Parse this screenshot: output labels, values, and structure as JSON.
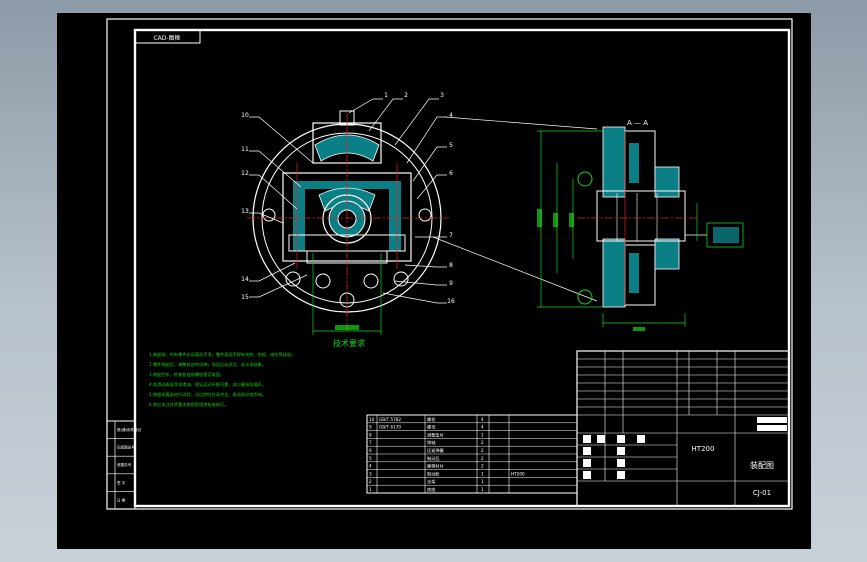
{
  "drawing": {
    "corner_label": "CAD-图框",
    "section_label": "A — A",
    "title_heading": "技术要求",
    "notes": [
      "1.装配前，所有零件必须清洗干净，零件表面不得有毛刺、划痕、碰伤等缺陷。",
      "2.零件装配后，调整各部件间隙，保证运动灵活、无卡滞现象。",
      "3.装配完毕，检查各连接螺栓是否紧固。",
      "4.各滑动表面涂润滑油，保证运动平稳可靠，减少磨损及噪声。",
      "5.按图纸要求进行试验，试运转时应无冲击、振动和异常声响。",
      "6.其它未注技术要求按国家相关标准执行。"
    ],
    "left_stamp": [
      "借(通)用件登记",
      "旧底图总号",
      "底图总号",
      "签  字",
      "日  期"
    ],
    "parts_rows": [
      {
        "no": "10",
        "code": "GB/T 5782",
        "name": "螺栓",
        "qty": "4",
        "mat": ""
      },
      {
        "no": "9",
        "code": "GB/T 6170",
        "name": "螺母",
        "qty": "4",
        "mat": ""
      },
      {
        "no": "8",
        "code": "",
        "name": "调整垫片",
        "qty": "1",
        "mat": ""
      },
      {
        "no": "7",
        "code": "",
        "name": "销轴",
        "qty": "2",
        "mat": ""
      },
      {
        "no": "6",
        "code": "",
        "name": "压紧弹簧",
        "qty": "2",
        "mat": ""
      },
      {
        "no": "5",
        "code": "",
        "name": "制动瓦",
        "qty": "2",
        "mat": ""
      },
      {
        "no": "4",
        "code": "",
        "name": "摩擦衬片",
        "qty": "2",
        "mat": ""
      },
      {
        "no": "3",
        "code": "",
        "name": "制动轮",
        "qty": "1",
        "mat": "HT200"
      },
      {
        "no": "2",
        "code": "",
        "name": "支架",
        "qty": "1",
        "mat": ""
      },
      {
        "no": "1",
        "code": "",
        "name": "底座",
        "qty": "1",
        "mat": ""
      }
    ],
    "title_block": {
      "material": "HT200",
      "drawing_name": "装配图",
      "drawing_no": "CJ-01"
    }
  }
}
